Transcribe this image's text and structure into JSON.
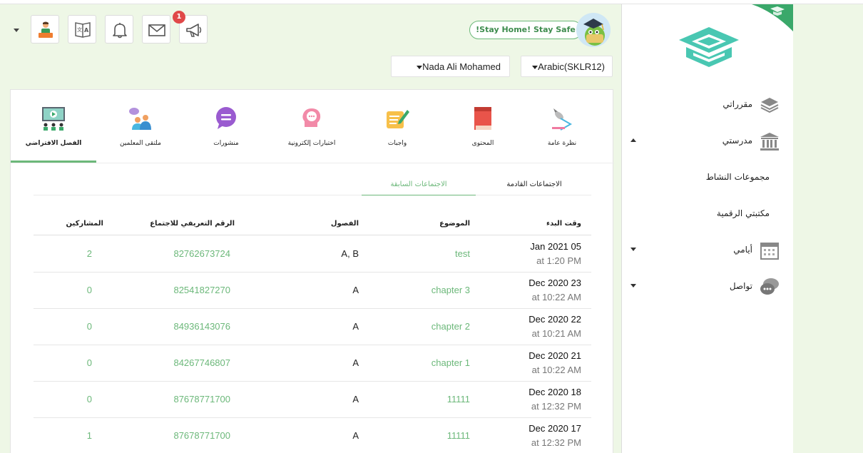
{
  "colors": {
    "accent": "#6cb87a",
    "badge": "#e04848",
    "background": "#eef7e6"
  },
  "toolbar": {
    "buttons": [
      {
        "icon": "student-avatar-icon"
      },
      {
        "icon": "translate-icon"
      },
      {
        "icon": "bell-icon"
      },
      {
        "icon": "mail-icon"
      },
      {
        "icon": "megaphone-icon",
        "badge": "1"
      }
    ],
    "stay_home": "!Stay Home! Stay Safe",
    "user_select": "Nada Ali Mohamed",
    "course_select": "Arabic(SKLR12)"
  },
  "sidebar": {
    "items": [
      {
        "label": "مقرراتي",
        "icon": "books-stack-icon",
        "caret": ""
      },
      {
        "label": "مدرستي",
        "icon": "school-building-icon",
        "caret": "up"
      },
      {
        "label": "أيامي",
        "icon": "calendar-icon",
        "caret": "down"
      },
      {
        "label": "تواصل",
        "icon": "chat-bubbles-icon",
        "caret": "down"
      }
    ],
    "subitems": [
      "مجموعات النشاط",
      "مكتبتي الرقمية"
    ]
  },
  "modules": [
    {
      "label": "نظرة عامة",
      "icon": "overview-lamp-icon"
    },
    {
      "label": "المحتوى",
      "icon": "book-icon"
    },
    {
      "label": "واجبات",
      "icon": "homework-pencil-icon"
    },
    {
      "label": "اختبارات إلكترونية",
      "icon": "quiz-head-icon"
    },
    {
      "label": "منشورات",
      "icon": "posts-bubble-icon"
    },
    {
      "label": "ملتقى المعلمين",
      "icon": "teachers-group-icon"
    },
    {
      "label": "الفصل الافتراضي",
      "icon": "virtual-class-icon",
      "active": true
    }
  ],
  "tabs": {
    "upcoming": "الاجتماعات القادمة",
    "past": "الاجتماعات السابقة"
  },
  "table": {
    "headers": {
      "start_time": "وقت البدء",
      "topic": "الموضوع",
      "classes": "الفصول",
      "meeting_id": "الرقم التعريفي للاجتماع",
      "participants": "المشاركين"
    },
    "rows": [
      {
        "date": "Jan 2021 05",
        "time": "at 1:20 PM",
        "topic": "test",
        "classes": "A, B",
        "meeting_id": "82762673724",
        "participants": "2"
      },
      {
        "date": "Dec 2020 23",
        "time": "at 10:22 AM",
        "topic": "chapter 3",
        "classes": "A",
        "meeting_id": "82541827270",
        "participants": "0"
      },
      {
        "date": "Dec 2020 22",
        "time": "at 10:21 AM",
        "topic": "chapter 2",
        "classes": "A",
        "meeting_id": "84936143076",
        "participants": "0"
      },
      {
        "date": "Dec 2020 21",
        "time": "at 10:22 AM",
        "topic": "chapter 1",
        "classes": "A",
        "meeting_id": "84267746807",
        "participants": "0"
      },
      {
        "date": "Dec 2020 18",
        "time": "at 12:32 PM",
        "topic": "11111",
        "classes": "A",
        "meeting_id": "87678771700",
        "participants": "0"
      },
      {
        "date": "Dec 2020 17",
        "time": "at 12:32 PM",
        "topic": "11111",
        "classes": "A",
        "meeting_id": "87678771700",
        "participants": "1"
      }
    ]
  }
}
